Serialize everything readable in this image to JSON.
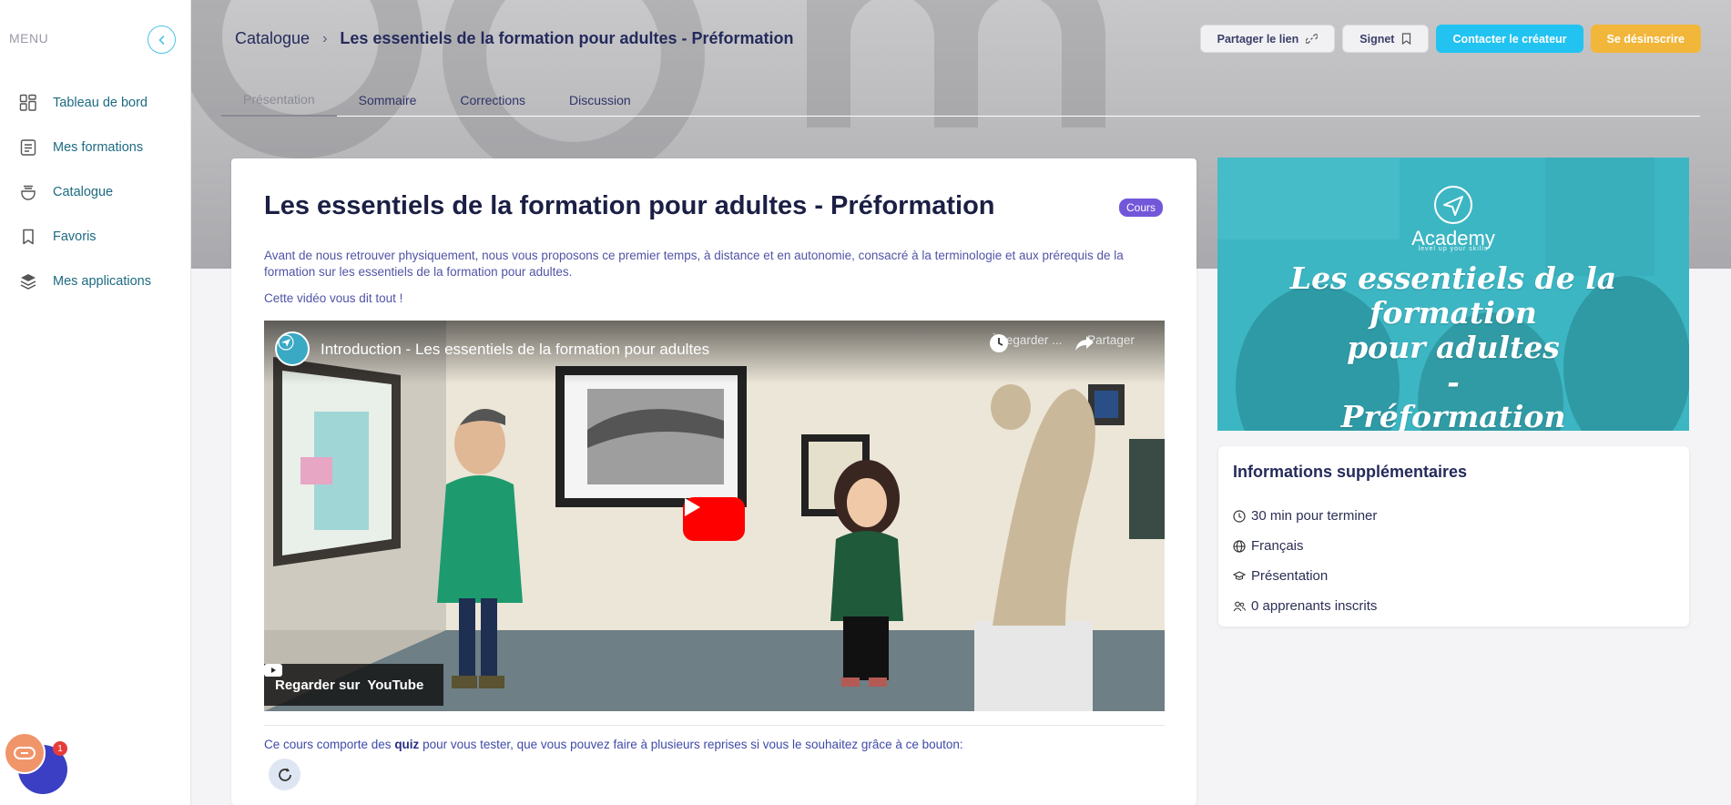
{
  "sidebar": {
    "menu_title": "MENU",
    "items": [
      {
        "label": "Tableau de bord",
        "icon": "dashboard-grid-icon"
      },
      {
        "label": "Mes formations",
        "icon": "document-list-icon"
      },
      {
        "label": "Catalogue",
        "icon": "bowl-catalog-icon"
      },
      {
        "label": "Favoris",
        "icon": "bookmark-icon"
      },
      {
        "label": "Mes applications",
        "icon": "layers-icon"
      }
    ]
  },
  "header": {
    "breadcrumb_root": "Catalogue",
    "breadcrumb_sep": "›",
    "breadcrumb_current": "Les essentiels de la formation pour adultes - Préformation",
    "actions": {
      "share": "Partager le lien",
      "bookmark": "Signet",
      "contact": "Contacter le créateur",
      "unsubscribe": "Se désinscrire"
    },
    "tabs": [
      "Présentation",
      "Sommaire",
      "Corrections",
      "Discussion"
    ],
    "active_tab": "Présentation"
  },
  "course": {
    "title": "Les essentiels de la formation pour adultes - Préformation",
    "badge": "Cours",
    "description": "Avant de nous retrouver physiquement, nous vous proposons ce premier temps, à distance et en autonomie, consacré à la terminologie et aux prérequis de la formation sur les essentiels de la formation pour adultes.",
    "video_intro": "Cette vidéo vous dit tout !",
    "video": {
      "title": "Introduction - Les essentiels de la formation pour adultes",
      "watch_later": "À regarder ...",
      "share": "Partager",
      "watch_on": "Regarder sur",
      "platform": "YouTube"
    },
    "quiz_note_before": "Ce cours comporte des ",
    "quiz_note_bold": "quiz",
    "quiz_note_after": " pour vous tester, que vous pouvez faire à plusieurs reprises si vous le souhaitez grâce à ce bouton:"
  },
  "promo": {
    "brand": "Academy",
    "tagline": "level up your skills",
    "title_line1": "Les essentiels de la formation",
    "title_line2": "pour adultes",
    "title_line3": "-",
    "title_line4": "Préformation"
  },
  "info": {
    "title": "Informations supplémentaires",
    "rows": [
      {
        "icon": "clock-icon",
        "text": "30 min pour terminer"
      },
      {
        "icon": "globe-icon",
        "text": "Français"
      },
      {
        "icon": "graduation-cap-icon",
        "text": "Présentation"
      },
      {
        "icon": "users-icon",
        "text": "0 apprenants inscrits"
      }
    ]
  },
  "widgets": {
    "notification_count": "1"
  },
  "colors": {
    "accent_cyan": "#22c3f0",
    "accent_yellow": "#f2b63b",
    "badge_purple": "#7257d9",
    "nav_text": "#1d6a82",
    "youtube_red": "#ff0000"
  }
}
